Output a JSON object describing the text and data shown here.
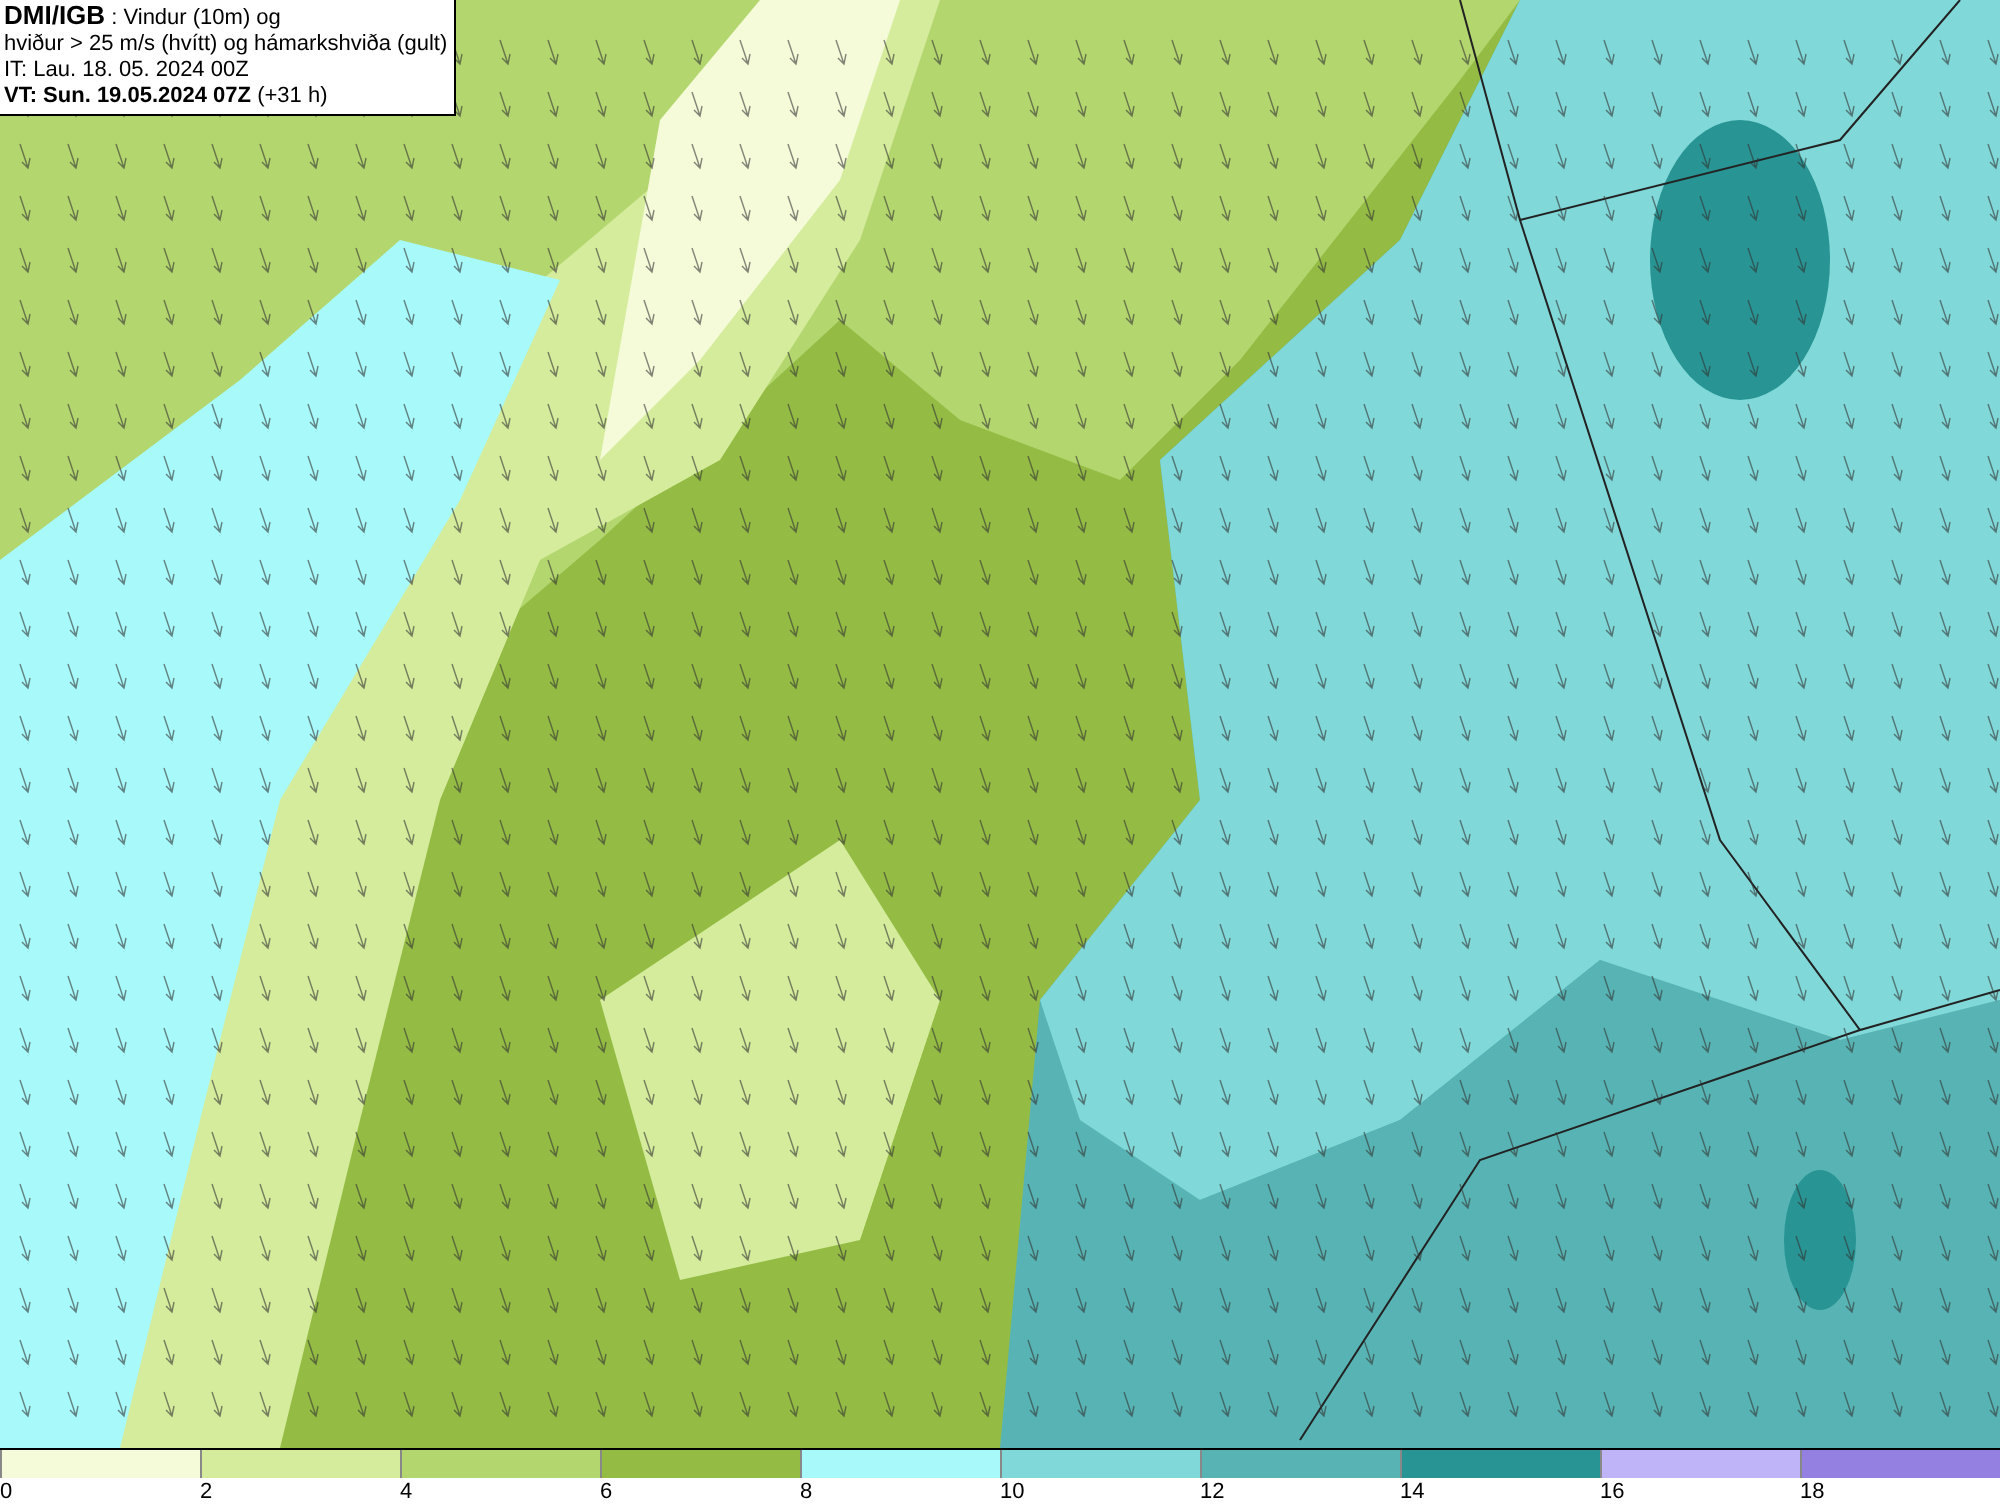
{
  "header": {
    "lines": [
      "**DMI/IGB** : Vindur (10m) og",
      "hviður > 25 m/s (hvítt) og hámarkshviða (gult)",
      "IT: Lau. 18. 05. 2024 00Z",
      "**VT: Sun. 19.05.2024 07Z** (+31 h)"
    ]
  },
  "legend": [
    {
      "label": "0",
      "color": "#f5fbd9"
    },
    {
      "label": "2",
      "color": "#d4ec9c"
    },
    {
      "label": "4",
      "color": "#b3d66e"
    },
    {
      "label": "6",
      "color": "#94bc44"
    },
    {
      "label": "8",
      "color": "#a8fafa"
    },
    {
      "label": "10",
      "color": "#80d8d8"
    },
    {
      "label": "12",
      "color": "#58b4b4"
    },
    {
      "label": "14",
      "color": "#289494"
    },
    {
      "label": "16",
      "color": "#c0b4f8"
    },
    {
      "label": "18",
      "color": "#9480e0"
    }
  ]
}
